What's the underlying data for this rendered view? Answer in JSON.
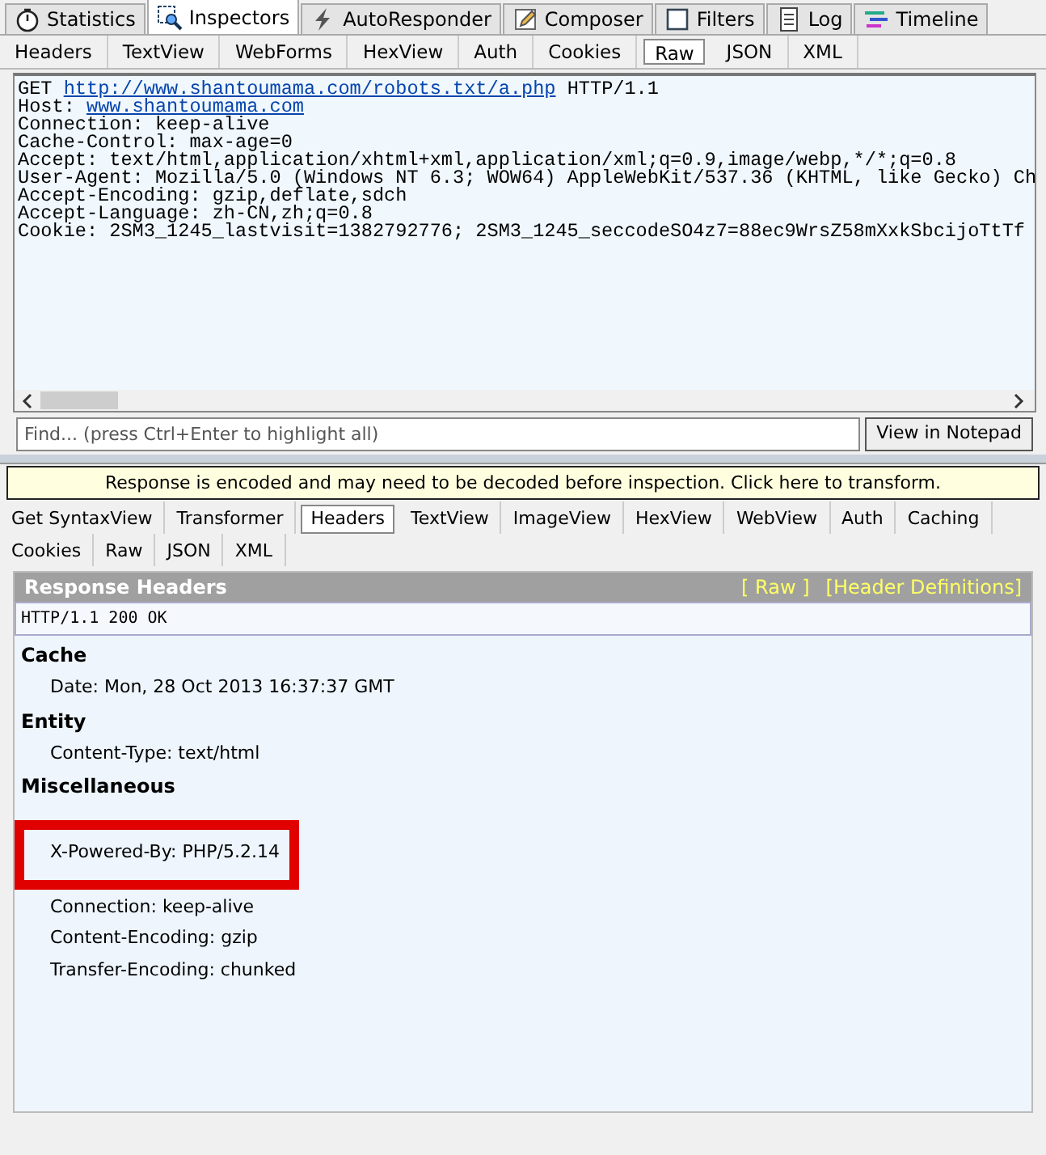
{
  "main_tabs": [
    {
      "label": "Statistics",
      "selected": false
    },
    {
      "label": "Inspectors",
      "selected": true
    },
    {
      "label": "AutoResponder",
      "selected": false
    },
    {
      "label": "Composer",
      "selected": false
    },
    {
      "label": "Filters",
      "selected": false
    },
    {
      "label": "Log",
      "selected": false
    },
    {
      "label": "Timeline",
      "selected": false
    }
  ],
  "request": {
    "tabs": [
      {
        "label": "Headers",
        "selected": false
      },
      {
        "label": "TextView",
        "selected": false
      },
      {
        "label": "WebForms",
        "selected": false
      },
      {
        "label": "HexView",
        "selected": false
      },
      {
        "label": "Auth",
        "selected": false
      },
      {
        "label": "Cookies",
        "selected": false
      },
      {
        "label": "Raw",
        "selected": true
      },
      {
        "label": "JSON",
        "selected": false
      },
      {
        "label": "XML",
        "selected": false
      }
    ],
    "lines": [
      [
        {
          "kind": "plain",
          "text": "GET "
        },
        {
          "kind": "link",
          "text": "http://www.shantoumama.com/robots.txt/a.php"
        },
        {
          "kind": "plain",
          "text": " HTTP/1.1"
        }
      ],
      [
        {
          "kind": "plain",
          "text": "Host: "
        },
        {
          "kind": "link",
          "text": "www.shantoumama.com"
        }
      ],
      [
        {
          "kind": "plain",
          "text": "Connection: keep-alive"
        }
      ],
      [
        {
          "kind": "plain",
          "text": "Cache-Control: max-age=0"
        }
      ],
      [
        {
          "kind": "plain",
          "text": "Accept: text/html,application/xhtml+xml,application/xml;q=0.9,image/webp,*/*;q=0.8"
        }
      ],
      [
        {
          "kind": "plain",
          "text": "User-Agent: Mozilla/5.0 (Windows NT 6.3; WOW64) AppleWebKit/537.36 (KHTML, like Gecko) Ch"
        }
      ],
      [
        {
          "kind": "plain",
          "text": "Accept-Encoding: gzip,deflate,sdch"
        }
      ],
      [
        {
          "kind": "plain",
          "text": "Accept-Language: zh-CN,zh;q=0.8"
        }
      ],
      [
        {
          "kind": "plain",
          "text": "Cookie: 2SM3_1245_lastvisit=1382792776; 2SM3_1245_seccodeSO4z7=88ec9WrsZ58mXxkSbcijoTtTf"
        }
      ]
    ],
    "find": {
      "placeholder": "Find... (press Ctrl+Enter to highlight all)"
    },
    "notepad_button": "View in Notepad"
  },
  "notice": "Response is encoded and may need to be decoded before inspection. Click here to transform.",
  "response": {
    "tabs": [
      {
        "label": "Get SyntaxView",
        "selected": false
      },
      {
        "label": "Transformer",
        "selected": false
      },
      {
        "label": "Headers",
        "selected": true
      },
      {
        "label": "TextView",
        "selected": false
      },
      {
        "label": "ImageView",
        "selected": false
      },
      {
        "label": "HexView",
        "selected": false
      },
      {
        "label": "WebView",
        "selected": false
      },
      {
        "label": "Auth",
        "selected": false
      },
      {
        "label": "Caching",
        "selected": false
      },
      {
        "label": "Cookies",
        "selected": false
      },
      {
        "label": "Raw",
        "selected": false
      },
      {
        "label": "JSON",
        "selected": false
      },
      {
        "label": "XML",
        "selected": false
      }
    ],
    "title": "Response Headers",
    "links": [
      "[ Raw ]",
      "[Header Definitions]"
    ],
    "status_line": "HTTP/1.1 200 OK",
    "groups": [
      {
        "name": "Cache",
        "items": [
          {
            "text": "Date: Mon, 28 Oct 2013 16:37:37 GMT",
            "highlighted": false
          }
        ]
      },
      {
        "name": "Entity",
        "items": [
          {
            "text": "Content-Type: text/html",
            "highlighted": false
          }
        ]
      },
      {
        "name": "Miscellaneous",
        "items": [
          {
            "text": "X-Powered-By: PHP/5.2.14",
            "highlighted": true
          }
        ]
      },
      {
        "items": [
          {
            "text": "Connection: keep-alive",
            "highlighted": false
          },
          {
            "text": "Content-Encoding: gzip",
            "highlighted": false
          },
          {
            "text": "Transfer-Encoding: chunked",
            "highlighted": false
          }
        ]
      }
    ]
  }
}
